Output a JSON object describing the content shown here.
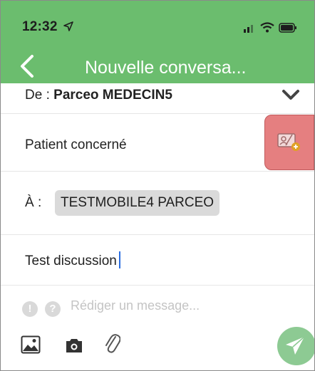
{
  "status_bar": {
    "time": "12:32",
    "icons": [
      "location-arrow-icon",
      "signal-icon",
      "wifi-icon",
      "battery-icon"
    ]
  },
  "nav": {
    "title": "Nouvelle conversa...",
    "back_icon": "chevron-left-icon"
  },
  "form": {
    "from_label": "De :",
    "from_value": "Parceo MEDECIN5",
    "patient_label": "Patient concerné",
    "to_label": "À :",
    "recipient": "TESTMOBILE4 PARCEO",
    "subject": "Test discussion",
    "message_placeholder": "Rédiger un message..."
  },
  "toolbar": {
    "icons": [
      "image-icon",
      "camera-icon",
      "paperclip-icon",
      "send-icon"
    ]
  },
  "colors": {
    "header": "#6bbd6e",
    "patient_button": "#e57f80",
    "send_button": "#8dca93",
    "chip": "#dadada"
  }
}
